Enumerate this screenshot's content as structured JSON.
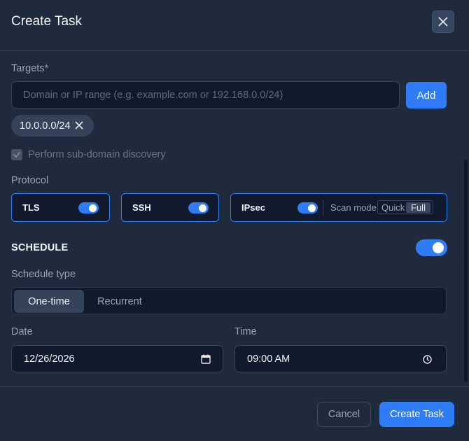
{
  "dialog": {
    "title": "Create Task",
    "close_icon": "close-icon"
  },
  "targets": {
    "label": "Targets",
    "required_mark": "*",
    "placeholder": "Domain or IP range (e.g. example.com or 192.168.0.0/24)",
    "value": "",
    "add_label": "Add",
    "chips": [
      {
        "label": "10.0.0.0/24",
        "remove_icon": "close-icon"
      }
    ],
    "subdomain_discovery": {
      "label": "Perform sub-domain discovery",
      "checked": true,
      "disabled": true
    }
  },
  "protocol": {
    "label": "Protocol",
    "items": [
      {
        "name": "TLS",
        "enabled": true
      },
      {
        "name": "SSH",
        "enabled": true
      },
      {
        "name": "IPsec",
        "enabled": true,
        "scan_mode_label": "Scan mode",
        "scan_modes": [
          "Quick",
          "Full"
        ],
        "selected_mode": "Full"
      }
    ]
  },
  "schedule": {
    "title": "SCHEDULE",
    "enabled": true,
    "type_label": "Schedule type",
    "types": [
      "One-time",
      "Recurrent"
    ],
    "selected_type": "One-time",
    "date_label": "Date",
    "date_value": "12/26/2026",
    "date_icon": "calendar-icon",
    "time_label": "Time",
    "time_value": "09:00 AM",
    "time_icon": "clock-icon"
  },
  "footer": {
    "cancel_label": "Cancel",
    "create_label": "Create Task"
  },
  "colors": {
    "accent": "#2f7df6",
    "background": "#1f2a3c",
    "input_background": "#101a2c"
  }
}
